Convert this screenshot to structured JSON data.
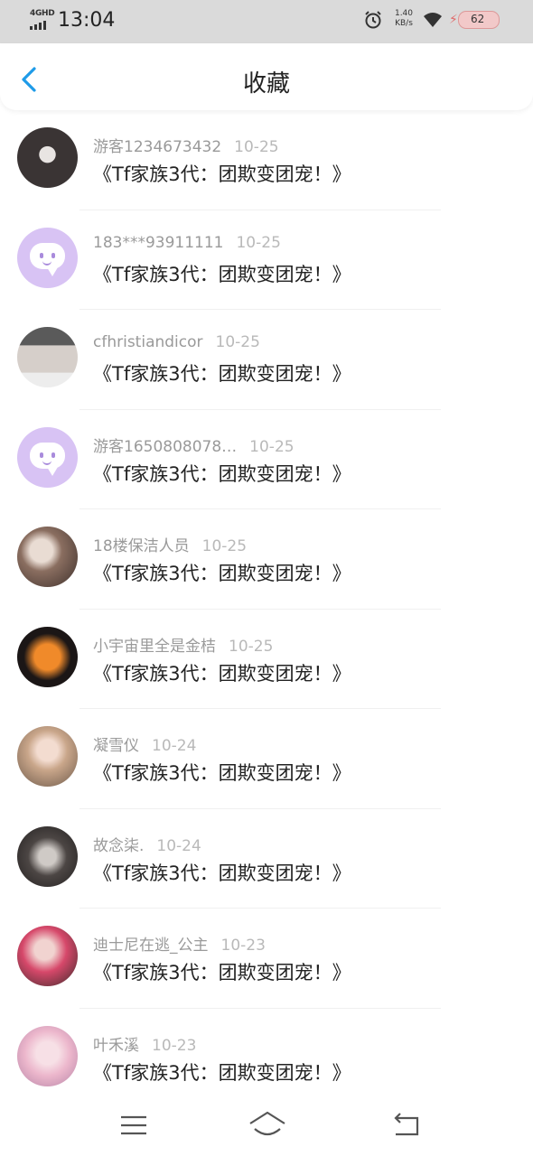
{
  "status_bar": {
    "network": "4GHD",
    "time": "13:04",
    "speed_value": "1.40",
    "speed_unit": "KB/s",
    "battery": "62"
  },
  "header": {
    "title": "收藏",
    "back_icon": "chevron-left-icon"
  },
  "colors": {
    "accent": "#1e9be8",
    "default_avatar_bg": "#d8c3f4"
  },
  "items": [
    {
      "user": "游客1234673432",
      "date": "10-25",
      "title": "《Tf家族3代：团欺变团宠！》",
      "avatar": "photo"
    },
    {
      "user": "183***93911111",
      "date": "10-25",
      "title": "《Tf家族3代：团欺变团宠！》",
      "avatar": "default-chat-icon"
    },
    {
      "user": "cfhristiandicor",
      "date": "10-25",
      "title": "《Tf家族3代：团欺变团宠！》",
      "avatar": "photo"
    },
    {
      "user": "游客1650808078…",
      "date": "10-25",
      "title": "《Tf家族3代：团欺变团宠！》",
      "avatar": "default-chat-icon"
    },
    {
      "user": "18楼保洁人员",
      "date": "10-25",
      "title": "《Tf家族3代：团欺变团宠！》",
      "avatar": "photo"
    },
    {
      "user": "小宇宙里全是金桔",
      "date": "10-25",
      "title": "《Tf家族3代：团欺变团宠！》",
      "avatar": "photo"
    },
    {
      "user": "凝雪仪",
      "date": "10-24",
      "title": "《Tf家族3代：团欺变团宠！》",
      "avatar": "photo"
    },
    {
      "user": "故念柒.",
      "date": "10-24",
      "title": "《Tf家族3代：团欺变团宠！》",
      "avatar": "photo"
    },
    {
      "user": "迪士尼在逃_公主",
      "date": "10-23",
      "title": "《Tf家族3代：团欺变团宠！》",
      "avatar": "photo"
    },
    {
      "user": "叶禾溪",
      "date": "10-23",
      "title": "《Tf家族3代：团欺变团宠！》",
      "avatar": "photo"
    }
  ],
  "nav": {
    "menu_icon": "menu-icon",
    "home_icon": "home-icon",
    "back_icon": "back-icon"
  }
}
